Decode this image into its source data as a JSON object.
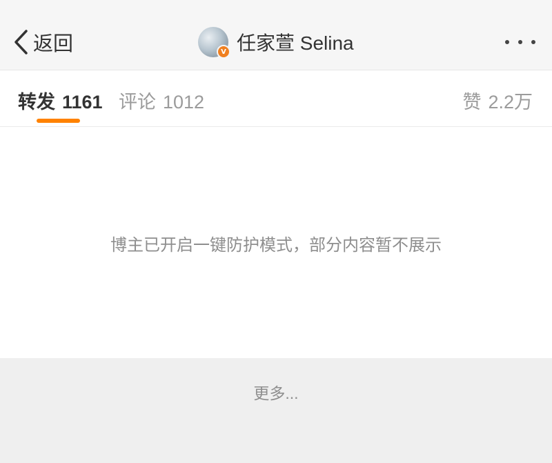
{
  "header": {
    "back_label": "返回",
    "title": "任家萱 Selina",
    "verified_badge": "V",
    "more_icon": "more-horizontal-icon"
  },
  "tabs": {
    "repost": {
      "label": "转发",
      "count": "1161"
    },
    "comment": {
      "label": "评论",
      "count": "1012"
    },
    "like": {
      "label": "赞",
      "count": "2.2万"
    }
  },
  "notice": "博主已开启一键防护模式，部分内容暂不展示",
  "footer": {
    "more_label": "更多..."
  },
  "colors": {
    "accent": "#ff8200",
    "verified": "#f08020",
    "text_primary": "#333333",
    "text_secondary": "#9b9b9b",
    "header_bg": "#f6f6f6",
    "footer_bg": "#efefef"
  }
}
